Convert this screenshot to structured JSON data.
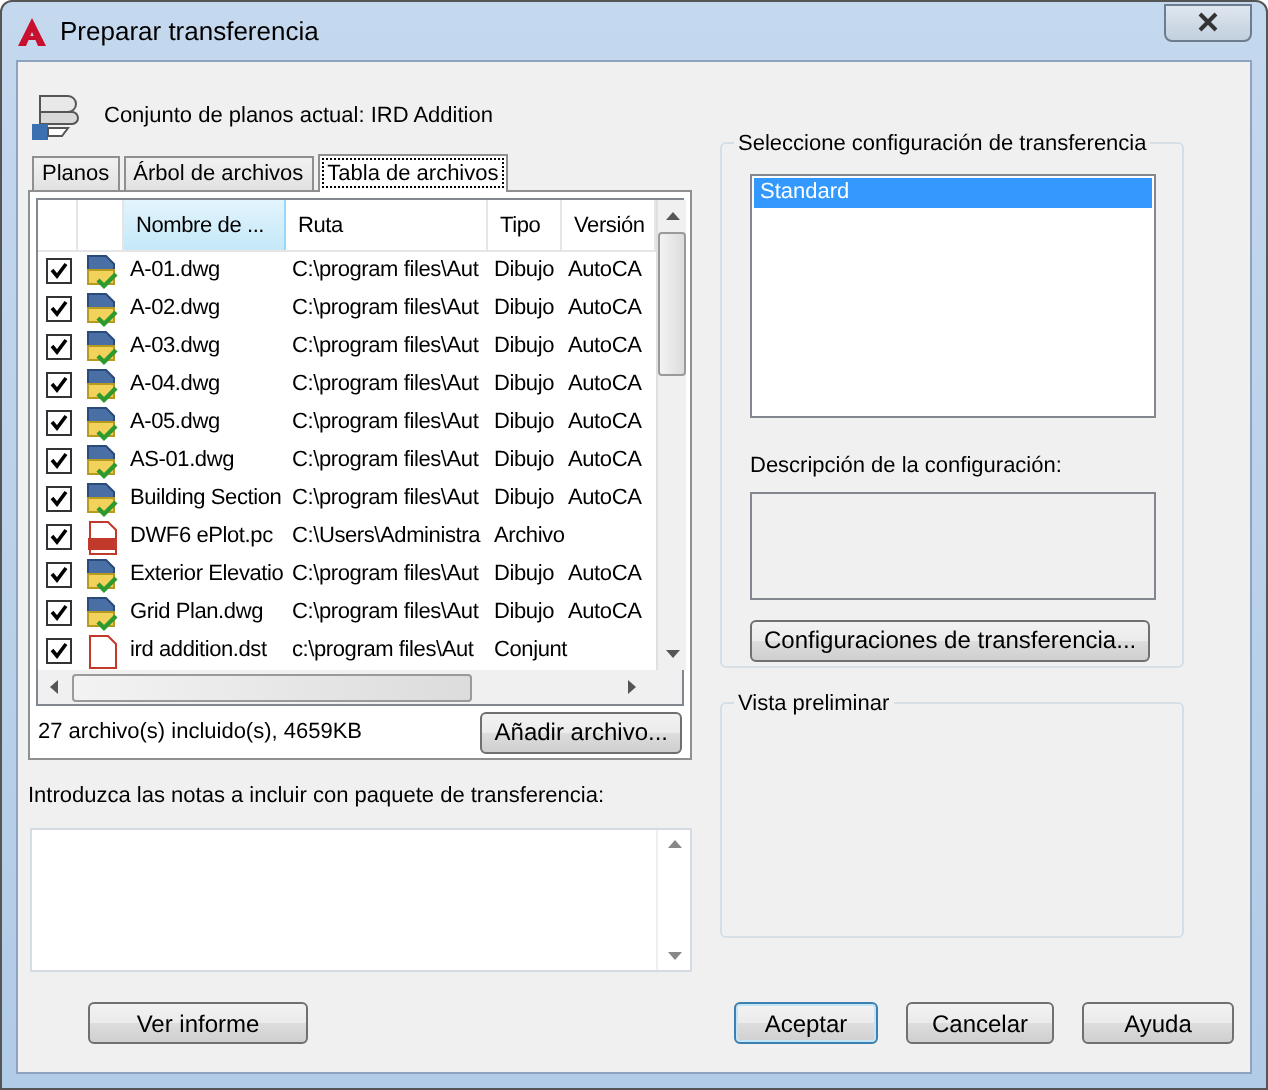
{
  "window": {
    "title": "Preparar transferencia"
  },
  "sheet_set": {
    "label": "Conjunto de planos actual: IRD Addition"
  },
  "tabs": [
    {
      "label": "Planos",
      "selected": false
    },
    {
      "label": "Árbol de archivos",
      "selected": false
    },
    {
      "label": "Tabla de archivos",
      "selected": true
    }
  ],
  "table": {
    "columns": [
      {
        "label": "Nombre de ...",
        "sorted": true
      },
      {
        "label": "Ruta",
        "sorted": false
      },
      {
        "label": "Tipo",
        "sorted": false
      },
      {
        "label": "Versión",
        "sorted": false
      }
    ],
    "rows": [
      {
        "checked": true,
        "kind": "dwg",
        "cells": [
          "A-01.dwg",
          "C:\\program files\\Aut",
          "Dibujo",
          "AutoCA"
        ]
      },
      {
        "checked": true,
        "kind": "dwg",
        "cells": [
          "A-02.dwg",
          "C:\\program files\\Aut",
          "Dibujo",
          "AutoCA"
        ]
      },
      {
        "checked": true,
        "kind": "dwg",
        "cells": [
          "A-03.dwg",
          "C:\\program files\\Aut",
          "Dibujo",
          "AutoCA"
        ]
      },
      {
        "checked": true,
        "kind": "dwg",
        "cells": [
          "A-04.dwg",
          "C:\\program files\\Aut",
          "Dibujo",
          "AutoCA"
        ]
      },
      {
        "checked": true,
        "kind": "dwg",
        "cells": [
          "A-05.dwg",
          "C:\\program files\\Aut",
          "Dibujo",
          "AutoCA"
        ]
      },
      {
        "checked": true,
        "kind": "dwg",
        "cells": [
          "AS-01.dwg",
          "C:\\program files\\Aut",
          "Dibujo",
          "AutoCA"
        ]
      },
      {
        "checked": true,
        "kind": "dwg",
        "cells": [
          "Building Section",
          "C:\\program files\\Aut",
          "Dibujo",
          "AutoCA"
        ]
      },
      {
        "checked": true,
        "kind": "pc3",
        "cells": [
          "DWF6 ePlot.pc",
          "C:\\Users\\Administra",
          "Archivo",
          ""
        ]
      },
      {
        "checked": true,
        "kind": "dwg",
        "cells": [
          "Exterior Elevatio",
          "C:\\program files\\Aut",
          "Dibujo",
          "AutoCA"
        ]
      },
      {
        "checked": true,
        "kind": "dwg",
        "cells": [
          "Grid Plan.dwg",
          "C:\\program files\\Aut",
          "Dibujo",
          "AutoCA"
        ]
      },
      {
        "checked": true,
        "kind": "dst",
        "cells": [
          "ird addition.dst",
          "c:\\program files\\Aut",
          "Conjunt",
          ""
        ]
      }
    ]
  },
  "summary": "27 archivo(s) incluido(s), 4659KB",
  "add_button": "Añadir archivo...",
  "notes": {
    "label": "Introduzca las notas a incluir con paquete de transferencia:"
  },
  "setups": {
    "title": "Seleccione configuración de transferencia",
    "items": [
      {
        "label": "Standard",
        "selected": true
      }
    ],
    "description_label": "Descripción de la configuración:",
    "button": "Configuraciones de transferencia..."
  },
  "preview": {
    "title": "Vista preliminar"
  },
  "buttons": [
    {
      "label": "Ver informe",
      "default": false
    },
    {
      "label": "Aceptar",
      "default": true
    },
    {
      "label": "Cancelar",
      "default": false
    },
    {
      "label": "Ayuda",
      "default": false
    }
  ]
}
